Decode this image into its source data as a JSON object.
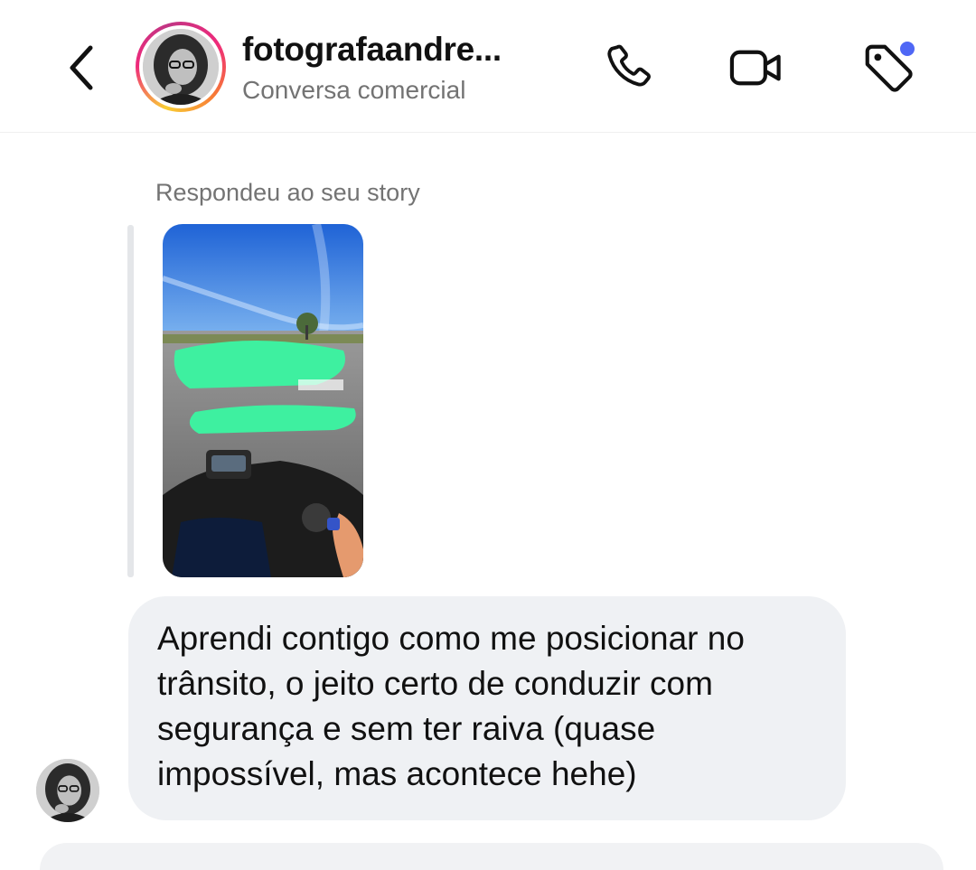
{
  "colors": {
    "background": "#ffffff",
    "bubble": "#eff1f4",
    "secondary_text": "#737373",
    "notification_dot": "#4f67f5",
    "mask_green": "#3ef0a0"
  },
  "header": {
    "back_icon": "chevron-left-icon",
    "username": "fotografaandre...",
    "subtitle": "Conversa comercial",
    "actions": [
      {
        "name": "call",
        "icon": "phone-icon"
      },
      {
        "name": "video-call",
        "icon": "video-camera-icon"
      },
      {
        "name": "labels",
        "icon": "tag-icon",
        "badge": true
      }
    ]
  },
  "conversation": {
    "reply_note": "Respondeu ao seu story",
    "story_thumbnail": "motorcycle-road-photo",
    "message": {
      "lines": [
        "Aprendi contigo como me posicionar no",
        "trânsito, o jeito certo de conduzir com",
        "segurança e sem ter raiva (quase",
        "impossível, mas acontece hehe)"
      ]
    }
  }
}
